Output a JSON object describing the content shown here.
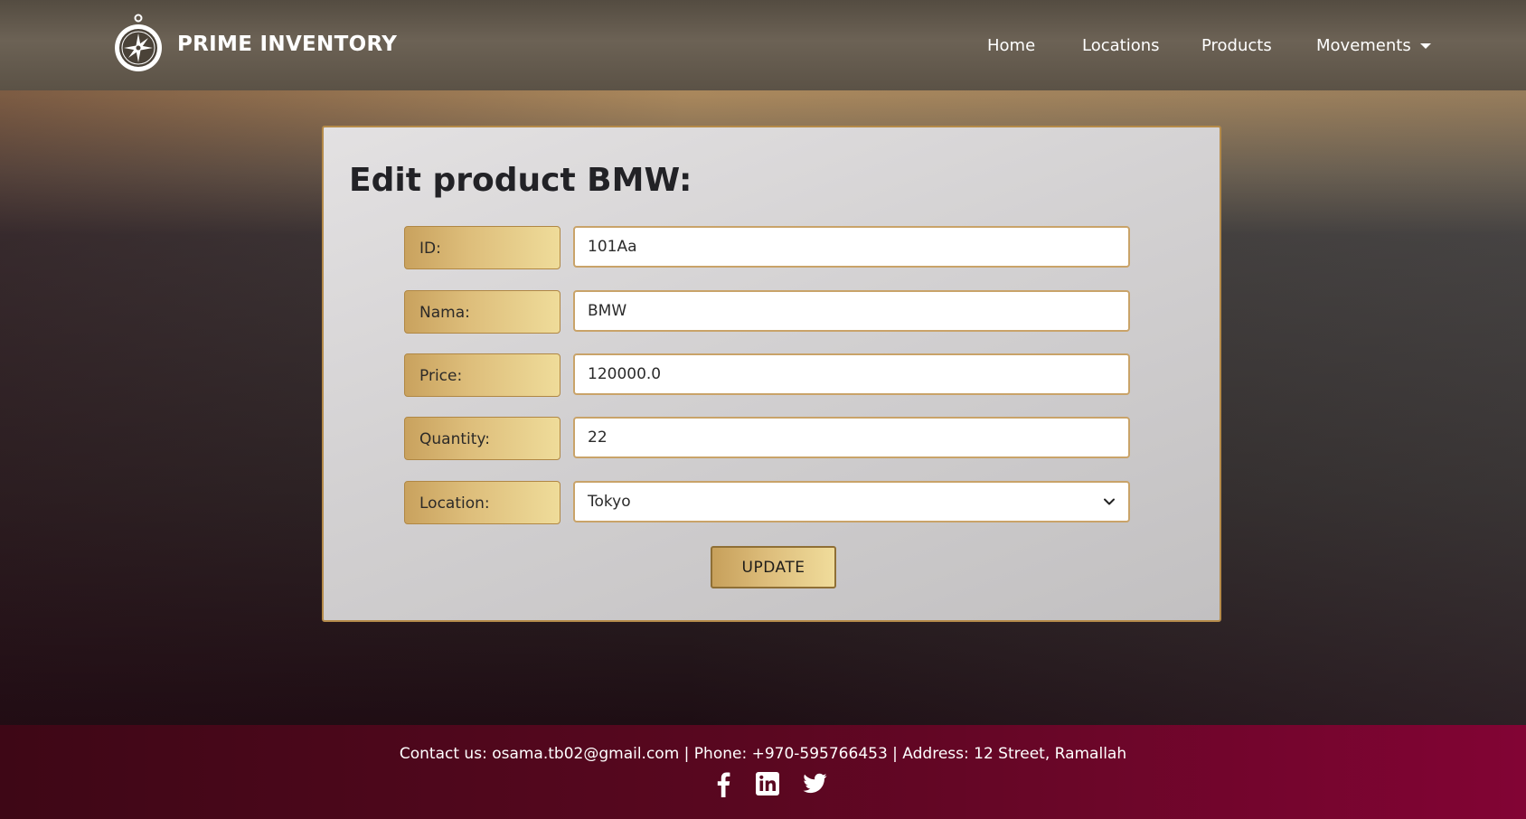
{
  "navbar": {
    "brand": "PRIME INVENTORY",
    "links": [
      {
        "label": "Home"
      },
      {
        "label": "Locations"
      },
      {
        "label": "Products"
      },
      {
        "label": "Movements"
      }
    ]
  },
  "form": {
    "title": "Edit product BMW:",
    "fields": [
      {
        "label": "ID:",
        "value": "101Aa"
      },
      {
        "label": "Nama:",
        "value": "BMW"
      },
      {
        "label": "Price:",
        "value": "120000.0"
      },
      {
        "label": "Quantity:",
        "value": "22"
      },
      {
        "label": "Location:",
        "value": "Tokyo"
      }
    ],
    "submit_label": "UPDATE"
  },
  "footer": {
    "contact": "Contact us: osama.tb02@gmail.com | Phone: +970-595766453 | Address: 12 Street, Ramallah",
    "socials": [
      {
        "icon": "facebook-icon"
      },
      {
        "icon": "linkedin-icon"
      },
      {
        "icon": "twitter-icon"
      }
    ]
  },
  "colors": {
    "accent_gold": "#d8b672",
    "footer_crimson": "#5a0720",
    "navbar_brown": "#655b4e"
  }
}
